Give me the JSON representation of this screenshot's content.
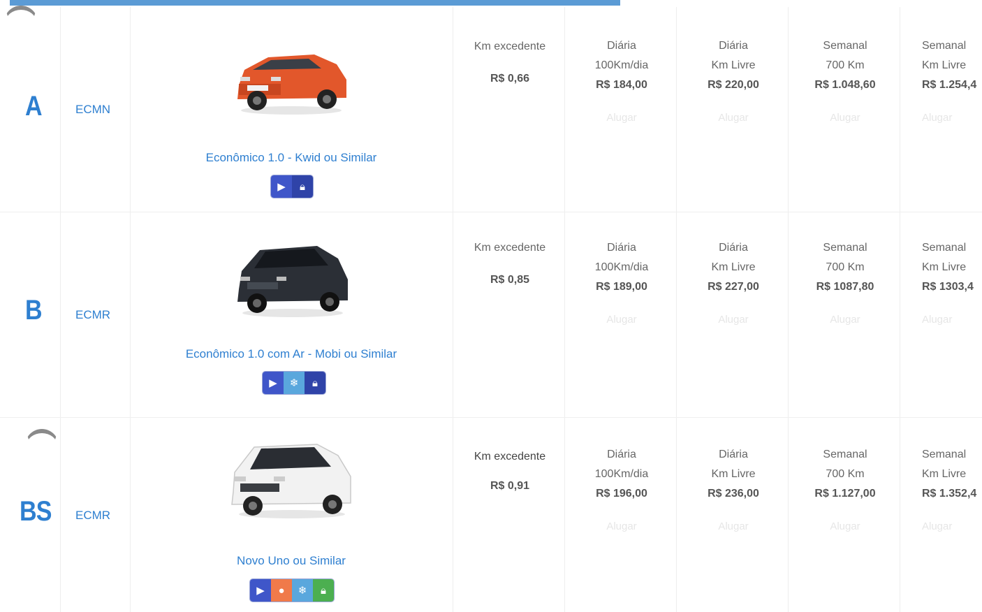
{
  "rows": [
    {
      "group": "A",
      "code": "ECMN",
      "car_name": "Econômico 1.0 - Kwid ou Similar",
      "car_color": "#e2572b",
      "icons": [
        "play-icon",
        "lock-icon"
      ],
      "km_excedente": {
        "label": "Km excedente",
        "price": "R$ 0,66"
      },
      "plans": [
        {
          "l1": "Diária",
          "l2": "100Km/dia",
          "price": "R$ 184,00",
          "action": "Alugar"
        },
        {
          "l1": "Diária",
          "l2": "Km Livre",
          "price": "R$ 220,00",
          "action": "Alugar"
        },
        {
          "l1": "Semanal",
          "l2": "700 Km",
          "price": "R$ 1.048,60",
          "action": "Alugar"
        },
        {
          "l1": "Semanal",
          "l2": "Km Livre",
          "price": "R$ 1.254,4",
          "action": "Alugar"
        }
      ]
    },
    {
      "group": "B",
      "code": "ECMR",
      "car_name": "Econômico 1.0 com Ar - Mobi ou Similar",
      "car_color": "#2b2f36",
      "icons": [
        "play-icon",
        "air-conditioning-icon",
        "lock-icon"
      ],
      "km_excedente": {
        "label": "Km excedente",
        "price": "R$ 0,85"
      },
      "plans": [
        {
          "l1": "Diária",
          "l2": "100Km/dia",
          "price": "R$ 189,00",
          "action": "Alugar"
        },
        {
          "l1": "Diária",
          "l2": "Km Livre",
          "price": "R$ 227,00",
          "action": "Alugar"
        },
        {
          "l1": "Semanal",
          "l2": "700 Km",
          "price": "R$ 1087,80",
          "action": "Alugar"
        },
        {
          "l1": "Semanal",
          "l2": "Km Livre",
          "price": "R$ 1303,4",
          "action": "Alugar"
        }
      ]
    },
    {
      "group": "BS",
      "code": "ECMR",
      "car_name": "Novo Uno ou Similar",
      "car_color": "#f2f2f2",
      "icons": [
        "play-icon",
        "airbag-icon",
        "air-conditioning-icon",
        "lock-icon"
      ],
      "km_excedente": {
        "label": "Km excedente",
        "price": "R$ 0,91"
      },
      "plans": [
        {
          "l1": "Diária",
          "l2": "100Km/dia",
          "price": "R$ 196,00",
          "action": "Alugar"
        },
        {
          "l1": "Diária",
          "l2": "Km Livre",
          "price": "R$ 236,00",
          "action": "Alugar"
        },
        {
          "l1": "Semanal",
          "l2": "700 Km",
          "price": "R$ 1.127,00",
          "action": "Alugar"
        },
        {
          "l1": "Semanal",
          "l2": "Km Livre",
          "price": "R$ 1.352,4",
          "action": "Alugar"
        }
      ]
    }
  ]
}
